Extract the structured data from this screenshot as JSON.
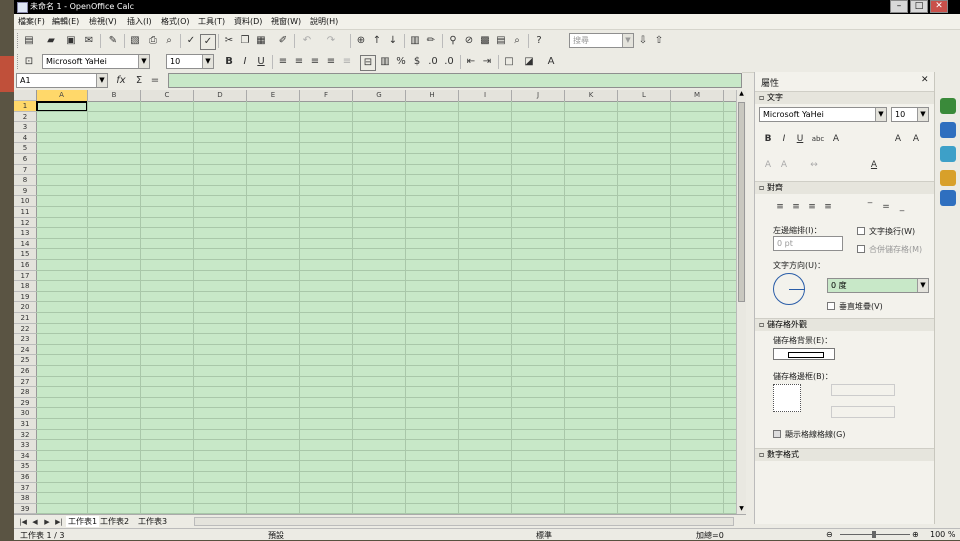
{
  "window": {
    "title": "未命名 1 - OpenOffice Calc",
    "controls": [
      "–",
      "□",
      "✕"
    ]
  },
  "menu": [
    "檔案(F)",
    "編輯(E)",
    "檢視(V)",
    "插入(I)",
    "格式(O)",
    "工具(T)",
    "資料(D)",
    "視窗(W)",
    "說明(H)"
  ],
  "toolbar": {
    "search_placeholder": "搜尋",
    "font_name": "Microsoft YaHei",
    "font_size": "10"
  },
  "formula": {
    "name_box": "A1",
    "fx": "fх",
    "sum": "Σ",
    "equals": "="
  },
  "grid": {
    "columns": [
      "A",
      "B",
      "C",
      "D",
      "E",
      "F",
      "G",
      "H",
      "I",
      "J",
      "K",
      "L",
      "M"
    ],
    "rows": [
      "1",
      "2",
      "3",
      "4",
      "5",
      "6",
      "7",
      "8",
      "9",
      "10",
      "11",
      "12",
      "13",
      "14",
      "15",
      "16",
      "17",
      "18",
      "19",
      "20",
      "21",
      "22",
      "23",
      "24",
      "25",
      "26",
      "27",
      "28",
      "29",
      "30",
      "31",
      "32",
      "33",
      "34",
      "35",
      "36",
      "37",
      "38",
      "39"
    ],
    "cell_color": "#c8e8c8"
  },
  "sheets": [
    "工作表1",
    "工作表2",
    "工作表3"
  ],
  "status": {
    "sheet": "工作表 1 / 3",
    "style": "預設",
    "mode": "標準",
    "sum": "加總=0",
    "zoom": "100 %"
  },
  "sidebar": {
    "title": "屬性",
    "text_section": "文字",
    "font_name": "Microsoft YaHei",
    "font_size": "10",
    "alignment_section": "對齊",
    "indent_label": "左邊縮排(I)：",
    "indent_value": "0 pt",
    "wrap_text": "文字換行(W)",
    "merge_cells": "合併儲存格(M)",
    "orientation_label": "文字方向(U)：",
    "orientation_value": "0 度",
    "vertical_stack": "垂直堆疊(V)",
    "cell_appearance_section": "儲存格外觀",
    "bg_label": "儲存格背景(E)：",
    "border_label": "儲存格邊框(B)：",
    "show_grid": "顯示格線格線(G)",
    "number_format_section": "數字格式"
  }
}
